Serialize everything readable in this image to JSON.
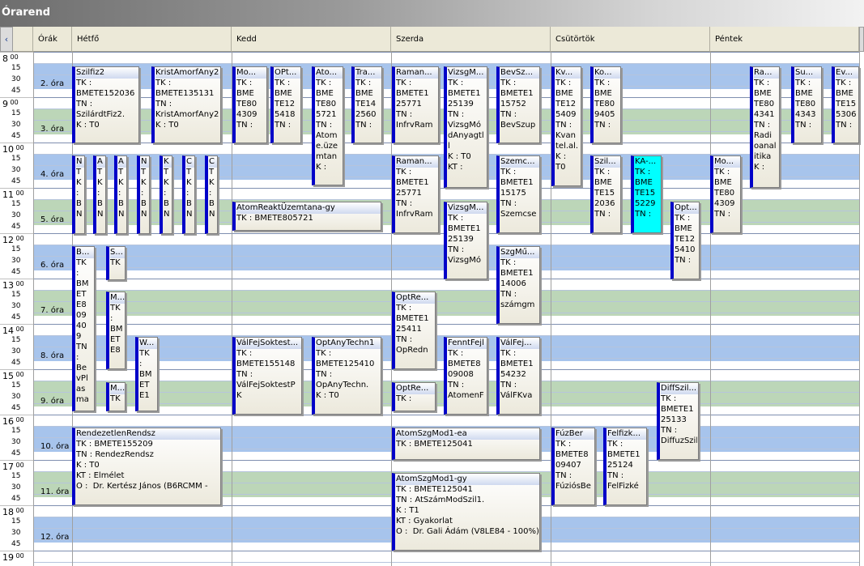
{
  "window": {
    "title": "Órarend"
  },
  "nav": {
    "prev": "‹"
  },
  "headers": {
    "orak": "Órák",
    "days": [
      "Hétfő",
      "Kedd",
      "Szerda",
      "Csütörtök",
      "Péntek"
    ]
  },
  "hours": [
    "8",
    "9",
    "10",
    "11",
    "12",
    "13",
    "14",
    "15",
    "16",
    "17",
    "18",
    "19"
  ],
  "minutes": [
    "00",
    "15",
    "30",
    "45"
  ],
  "periods": [
    "2. óra",
    "3. óra",
    "4. óra",
    "5. óra",
    "6. óra",
    "7. óra",
    "8. óra",
    "9. óra",
    "10. óra",
    "11. óra",
    "12. óra"
  ],
  "colors": {
    "blue_band": "#a7c4ec",
    "green_band": "#bcd6b8",
    "event_bar": "#0000c8",
    "highlight": "#00ffff"
  },
  "events": [
    {
      "title": "Szilfiz2",
      "body": "TK :\nBMETE152036\nTN :\nSzilárdtFiz2.\nK : T0"
    },
    {
      "title": "KristAmorfAny2",
      "body": "TK :\nBMETE135131\nTN :\nKristAmorfAny2.\nK : T0"
    },
    {
      "title": "Mo...",
      "body": "TK :\nBME\nTE80\n4309\nTN :"
    },
    {
      "title": "OPt...",
      "body": "TK :\nBME\nTE12\n5418\nTN :"
    },
    {
      "title": "Ato...",
      "body": "TK :\nBME\nTE80\n5721\nTN :\nAtom\ne.üze\nmtan\nK :"
    },
    {
      "title": "Tra...",
      "body": "TK :\nBME\nTE14\n2560\nTN :"
    },
    {
      "title": "Raman...",
      "body": "TK :\nBMETE1\n25771\nTN :\nInfrvRam"
    },
    {
      "title": "VizsgM...",
      "body": "TK :\nBMETE1\n25139\nTN :\nVizsgMó\ndAnyagtl\nl\nK : T0\nKT :"
    },
    {
      "title": "BevSz...",
      "body": "TK :\nBMETE1\n15752\nTN :\nBevSzup"
    },
    {
      "title": "Kv...",
      "body": "TK :\nBME\nTE12\n5409\nTN :\nKvan\ntel.al.\nK :\nT0"
    },
    {
      "title": "Ko...",
      "body": "TK :\nBME\nTE80\n9405\nTN :"
    },
    {
      "title": "Ra...",
      "body": "TK :\nBME\nTE80\n4341\nTN :\nRadi\noanal\nitika\nK :"
    },
    {
      "title": "Su...",
      "body": "TK :\nBME\nTE80\n4343\nTN :"
    },
    {
      "title": "Ev...",
      "body": "TK :\nBME\nTE15\n5306\nTN :"
    },
    {
      "title": "N",
      "body": "T\nK\n:\nB\nN"
    },
    {
      "title": "A",
      "body": "T\nK\n:\nB\nN"
    },
    {
      "title": "A",
      "body": "T\nK\n:\nB\nN"
    },
    {
      "title": "N",
      "body": "T\nK\n:\nB\nN"
    },
    {
      "title": "K",
      "body": "T\nK\n:\nB\nN"
    },
    {
      "title": "C",
      "body": "T\nK\n:\nB\nN"
    },
    {
      "title": "C",
      "body": "T\nK\n:\nB\nN"
    },
    {
      "title": "Raman...",
      "body": "TK :\nBMETE1\n25771\nTN :\nInfrvRam"
    },
    {
      "title": "Szemc...",
      "body": "TK :\nBMETE1\n15175\nTN :\nSzemcse"
    },
    {
      "title": "Szil...",
      "body": "TK :\nBME\nTE15\n2036\nTN :"
    },
    {
      "title": "KA-...",
      "body": "TK :\nBME\nTE15\n5229\nTN :"
    },
    {
      "title": "Mo...",
      "body": "TK :\nBME\nTE80\n4309\nTN :"
    },
    {
      "title": "AtomReaktÜzemtana-gy",
      "body": "TK : BMETE805721"
    },
    {
      "title": "VizsgM...",
      "body": "TK :\nBMETE1\n25139\nTN :\nVizsgMó"
    },
    {
      "title": "Opt...",
      "body": "TK :\nBME\nTE12\n5410\nTN :"
    },
    {
      "title": "B...",
      "body": "TK\n:\nBM\nET\nE8\n09\n40\n9\nTN\n:\nBe\nvPl\nas\nma"
    },
    {
      "title": "S...",
      "body": "TK"
    },
    {
      "title": "SzgMű...",
      "body": "TK :\nBMETE1\n14006\nTN :\nszámgm"
    },
    {
      "title": "M...",
      "body": "TK\n:\nBM\nET\nE8"
    },
    {
      "title": "OptRe...",
      "body": "TK :\nBMETE1\n25411\nTN :\nOpRedn"
    },
    {
      "title": "W...",
      "body": "TK\n:\nBM\nET\nE1"
    },
    {
      "title": "VálFejSoktest...",
      "body": "TK :\nBMETE155148\nTN :\nVálFejSoktestP\nK"
    },
    {
      "title": "OptAnyTechn1",
      "body": "TK :\nBMETE125410\nTN :\nOpAnyTechn.\nK : T0"
    },
    {
      "title": "FenntFejl",
      "body": "TK :\nBMETE8\n09008\nTN :\nAtomenF"
    },
    {
      "title": "VálFej...",
      "body": "TK :\nBMETE1\n54232\nTN :\nVálFKva"
    },
    {
      "title": "M...",
      "body": "TK"
    },
    {
      "title": "OptRe...",
      "body": "TK :"
    },
    {
      "title": "DiffSzil...",
      "body": "TK :\nBMETE1\n25133\nTN :\nDiffuzSzil"
    },
    {
      "title": "RendezetlenRendsz",
      "body": "TK : BMETE155209\nTN : RendezRendsz\nK : T0\nKT : Elmélet\nO :  Dr. Kertész János (B6RCMM -"
    },
    {
      "title": "AtomSzgMod1-ea",
      "body": "TK : BMETE125041"
    },
    {
      "title": "FúzBer",
      "body": "TK :\nBMETE8\n09407\nTN :\nFúziósBe"
    },
    {
      "title": "Felfizk...",
      "body": "TK :\nBMETE1\n25124\nTN :\nFelFizké"
    },
    {
      "title": "AtomSzgMod1-gy",
      "body": "TK : BMETE125041\nTN : AtSzámModSzil1.\nK : T1\nKT : Gyakorlat\nO :  Dr. Gali Ádám (V8LE84 - 100%)"
    }
  ]
}
